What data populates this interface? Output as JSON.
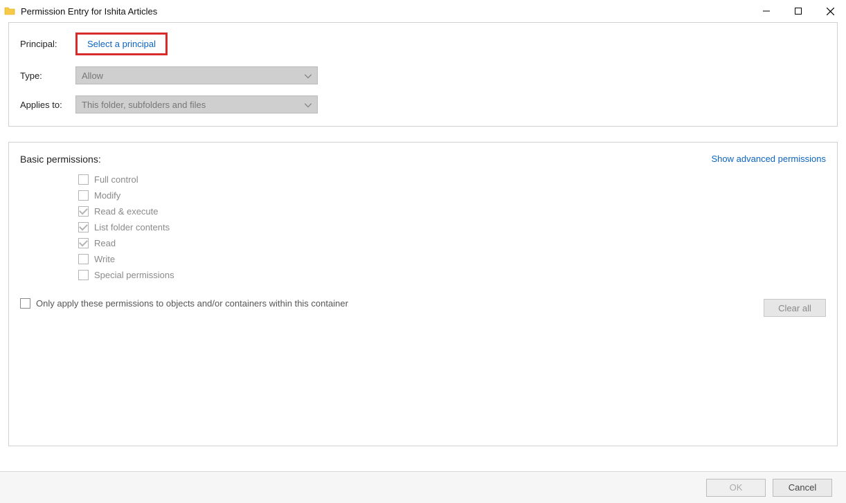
{
  "window": {
    "title": "Permission Entry for Ishita Articles"
  },
  "fields": {
    "principal_label": "Principal:",
    "principal_link": "Select a principal",
    "type_label": "Type:",
    "type_value": "Allow",
    "applies_to_label": "Applies to:",
    "applies_to_value": "This folder, subfolders and files"
  },
  "permissions": {
    "heading": "Basic permissions:",
    "show_advanced": "Show advanced permissions",
    "items": [
      {
        "label": "Full control",
        "checked": false
      },
      {
        "label": "Modify",
        "checked": false
      },
      {
        "label": "Read & execute",
        "checked": true
      },
      {
        "label": "List folder contents",
        "checked": true
      },
      {
        "label": "Read",
        "checked": true
      },
      {
        "label": "Write",
        "checked": false
      },
      {
        "label": "Special permissions",
        "checked": false
      }
    ],
    "only_apply_label": "Only apply these permissions to objects and/or containers within this container",
    "only_apply_checked": false,
    "clear_all": "Clear all"
  },
  "footer": {
    "ok": "OK",
    "cancel": "Cancel"
  }
}
